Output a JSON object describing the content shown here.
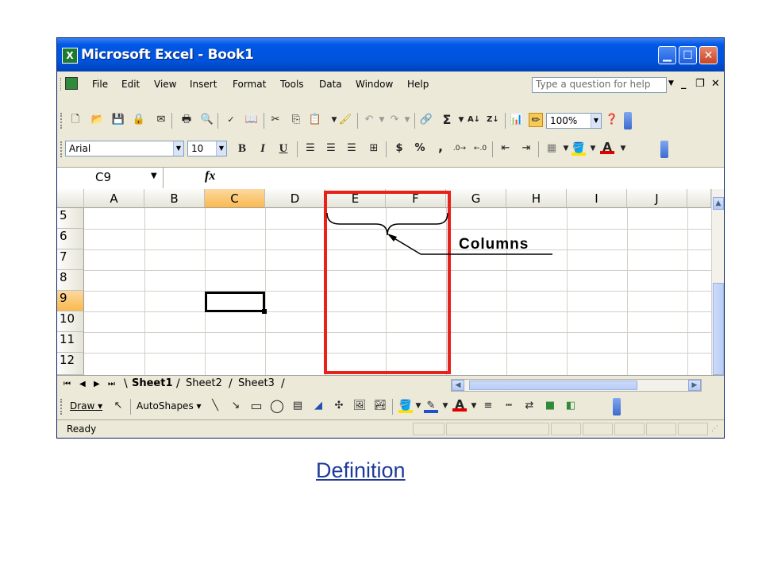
{
  "window": {
    "title": "Microsoft Excel - Book1",
    "app_icon": "X"
  },
  "menu": {
    "items": [
      "File",
      "Edit",
      "View",
      "Insert",
      "Format",
      "Tools",
      "Data",
      "Window",
      "Help"
    ],
    "help_placeholder": "Type a question for help"
  },
  "standard_toolbar": {
    "zoom": "100%"
  },
  "formatting_toolbar": {
    "font": "Arial",
    "size": "10",
    "bold": "B",
    "italic": "I",
    "underline": "U",
    "currency": "$",
    "percent": "%",
    "comma": ","
  },
  "formula_bar": {
    "name_box": "C9",
    "fx": "fx",
    "value": ""
  },
  "grid": {
    "columns": [
      "A",
      "B",
      "C",
      "D",
      "E",
      "F",
      "G",
      "H",
      "I",
      "J"
    ],
    "rows": [
      "5",
      "6",
      "7",
      "8",
      "9",
      "10",
      "11",
      "12"
    ],
    "active_column": "C",
    "active_row": "9",
    "selected_cell": "C9"
  },
  "sheets": {
    "tabs": [
      "Sheet1",
      "Sheet2",
      "Sheet3"
    ],
    "active": "Sheet1"
  },
  "drawing_toolbar": {
    "draw": "Draw",
    "autoshapes": "AutoShapes"
  },
  "status": {
    "text": "Ready"
  },
  "annotation": {
    "label": "Columns",
    "highlighted_columns": [
      "E",
      "F"
    ],
    "highlight_color": "#E8211A"
  },
  "link": {
    "text": "Definition",
    "color": "#1F3B99"
  }
}
